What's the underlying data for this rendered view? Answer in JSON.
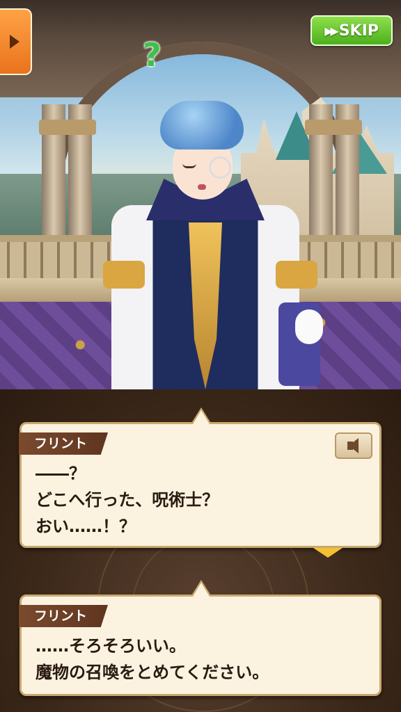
{
  "header": {
    "skip_label": "SKIP",
    "skip_icon": "fast-forward-icon",
    "menu_icon": "triangle-right-icon"
  },
  "scene": {
    "emote": "?"
  },
  "log": {
    "entries": [
      {
        "speaker": "フリント",
        "text": "――？\nどこへ行った、呪術士？\nおい……！？",
        "voice_icon": "speaker-icon"
      },
      {
        "speaker": "フリント",
        "text": "……そろそろいい。\n魔物の召喚をとめてください。"
      }
    ]
  },
  "colors": {
    "skip_button": "#5cbf24",
    "menu_button": "#f3882c",
    "name_tag": "#6b3e25",
    "dialog_bg": "#fbf3df",
    "next_arrow": "#f2c233"
  }
}
